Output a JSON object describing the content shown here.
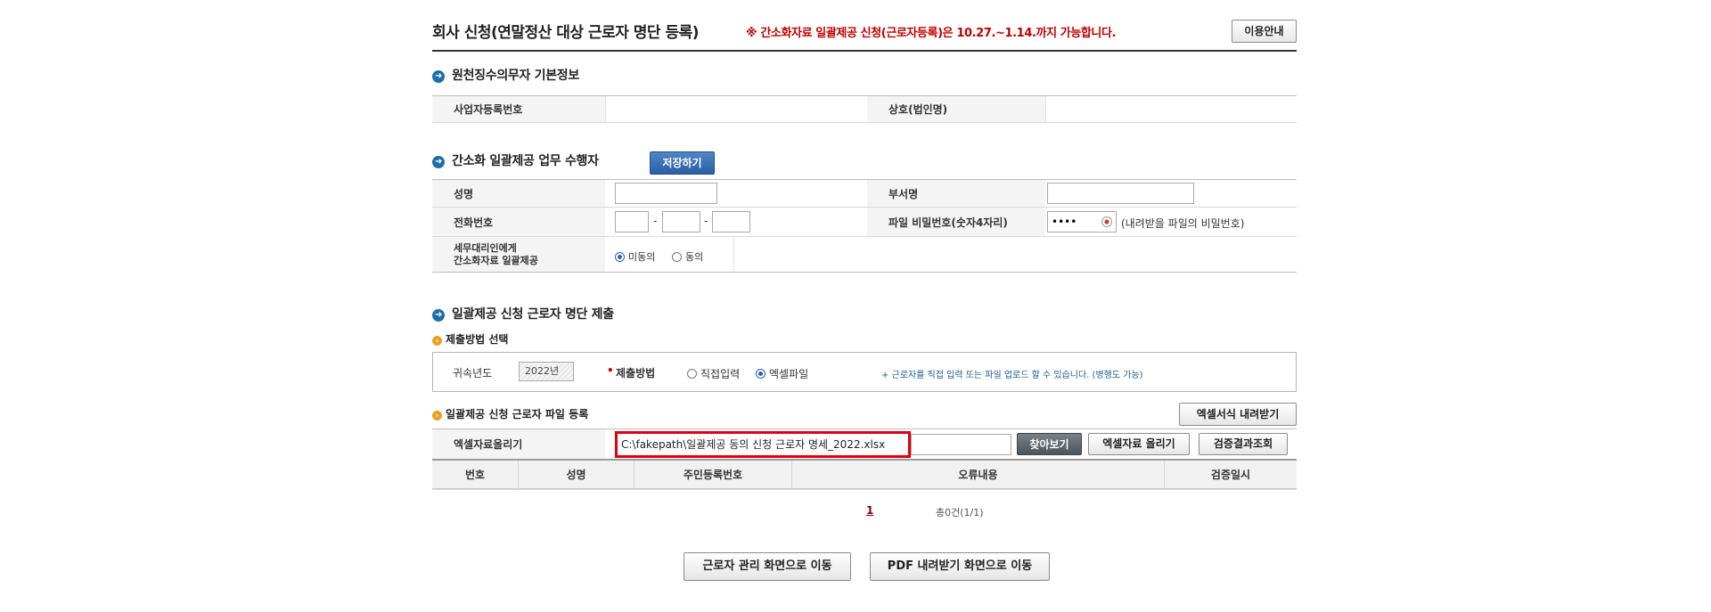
{
  "header": {
    "title": "회사 신청(연말정산 대상 근로자 명단 등록)",
    "notice": "※ 간소화자료 일괄제공 신청(근로자등록)은 10.27.~1.14.까지 가능합니다.",
    "guide_button": "이용안내"
  },
  "withholding": {
    "section_title": "원천징수의무자 기본정보",
    "biz_no_label": "사업자등록번호",
    "biz_no_value": "",
    "company_label": "상호(법인명)",
    "company_value": ""
  },
  "operator": {
    "section_title": "간소화 일괄제공 업무 수행자",
    "save_button": "저장하기",
    "name_label": "성명",
    "name_value": "",
    "dept_label": "부서명",
    "dept_value": "",
    "phone_label": "전화번호",
    "phone1": "",
    "phone2": "",
    "phone3": "",
    "dash": "-",
    "password_label": "파일 비밀번호(숫자4자리)",
    "password_value": "••••",
    "password_hint": "(내려받을 파일의 비밀번호)",
    "agent_label_line1": "세무대리인에게",
    "agent_label_line2": "간소화자료 일괄제공",
    "agent_options": [
      {
        "label": "미동의",
        "selected": true
      },
      {
        "label": "동의",
        "selected": false
      }
    ]
  },
  "submission": {
    "section_title": "일괄제공 신청 근로자 명단 제출",
    "method_subtitle": "제출방법 선택",
    "year_label": "귀속년도",
    "year_value": "2022년",
    "method_label": "제출방법",
    "required_mark": "•",
    "method_options": [
      {
        "label": "직접입력",
        "selected": false
      },
      {
        "label": "엑셀파일",
        "selected": true
      }
    ],
    "method_hint": "+ 근로자를 직접 입력 또는 파일 업로드 할 수 있습니다. (병행도 가능)"
  },
  "upload": {
    "subtitle": "일괄제공 신청 근로자 파일 등록",
    "template_button": "엑셀서식 내려받기",
    "upload_label": "엑셀자료올리기",
    "file_path": "C:\\fakepath\\일괄제공 동의 신청 근로자 명세_2022.xlsx",
    "browse_button": "찾아보기",
    "upload_button": "엑셀자료 올리기",
    "verify_button": "검증결과조회"
  },
  "result_table": {
    "columns": [
      "번호",
      "성명",
      "주민등록번호",
      "오류내용",
      "검증일시"
    ],
    "rows": []
  },
  "pagination": {
    "current_page": "1",
    "total_text": "총0건(1/1)"
  },
  "footer": {
    "worker_mgmt_button": "근로자 관리 화면으로 이동",
    "pdf_download_button": "PDF 내려받기 화면으로 이동"
  },
  "colors": {
    "notice_red": "#c00000",
    "section_bullet_blue": "#1d6fa8",
    "sub_bullet_orange": "#e5a225",
    "highlight_red": "#e0000e",
    "save_button_blue": "#2a5ea6"
  }
}
